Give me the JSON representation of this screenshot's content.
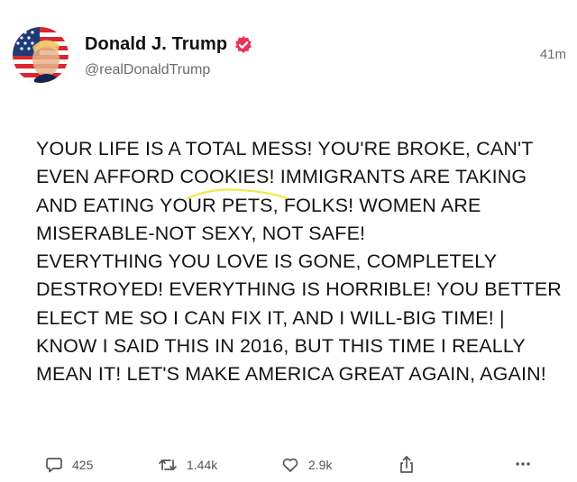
{
  "post": {
    "display_name": "Donald J. Trump",
    "handle": "@realDonaldTrump",
    "timestamp": "41m",
    "verified_icon": "verified-badge-icon",
    "body_lines": [
      "YOUR LIFE IS A TOTAL MESS! YOU'RE BROKE, CAN'T",
      "EVEN AFFORD COOKIES! IMMIGRANTS ARE TAKING",
      "AND EATING YOUR PETS, FOLKS! WOMEN ARE",
      "MISERABLE-NOT SEXY, NOT SAFE!",
      "EVERYTHING YOU LOVE IS GONE, COMPLETELY",
      "DESTROYED! EVERYTHING IS HORRIBLE! YOU BETTER",
      "ELECT ME SO I CAN FIX IT, AND I WILL-BIG TIME! |",
      "KNOW I SAID THIS IN 2016, BUT THIS TIME I REALLY",
      "MEAN IT! LET'S MAKE AMERICA GREAT AGAIN, AGAIN!"
    ]
  },
  "actions": {
    "reply_count": "425",
    "retruth_count": "1.44k",
    "like_count": "2.9k",
    "icons": [
      "reply-icon",
      "retruth-icon",
      "like-icon",
      "share-icon",
      "more-icon"
    ]
  },
  "colors": {
    "verified": "#e8335b",
    "highlight_stroke": "#f2e84a",
    "muted_text": "#6b6b6b"
  }
}
